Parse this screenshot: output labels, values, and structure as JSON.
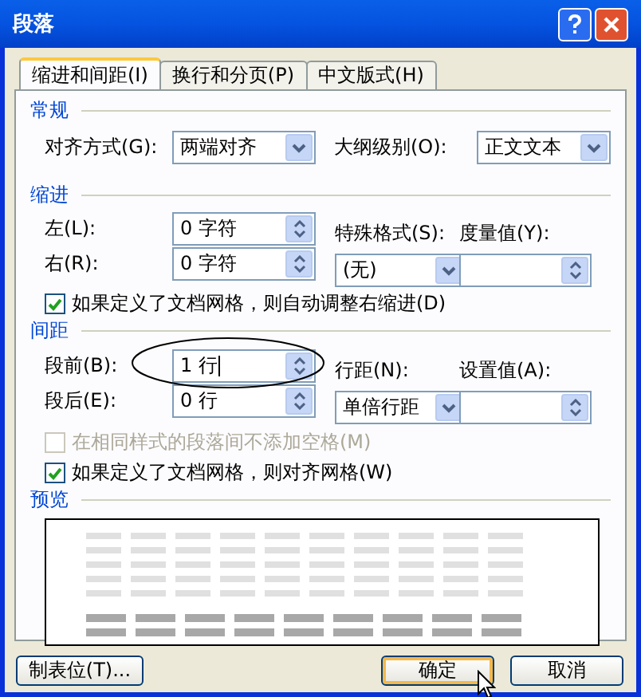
{
  "window": {
    "title": "段落"
  },
  "tabs": [
    {
      "label": "缩进和间距(I)",
      "selected": true
    },
    {
      "label": "换行和分页(P)",
      "selected": false
    },
    {
      "label": "中文版式(H)",
      "selected": false
    }
  ],
  "general": {
    "heading": "常规",
    "alignment": {
      "label": "对齐方式(G):",
      "value": "两端对齐"
    },
    "outline_level": {
      "label": "大纲级别(O):",
      "value": "正文文本"
    }
  },
  "indentation": {
    "heading": "缩进",
    "left": {
      "label": "左(L):",
      "value": "0 字符"
    },
    "right": {
      "label": "右(R):",
      "value": "0 字符"
    },
    "special": {
      "label": "特殊格式(S):",
      "value": "(无)"
    },
    "by": {
      "label": "度量值(Y):"
    },
    "auto_adjust": {
      "label": "如果定义了文档网格，则自动调整右缩进(D)",
      "checked": true,
      "disabled": false
    }
  },
  "spacing": {
    "heading": "间距",
    "before": {
      "label": "段前(B):",
      "value": "1 行",
      "focused": true
    },
    "after": {
      "label": "段后(E):",
      "value": "0 行"
    },
    "line_spacing": {
      "label": "行距(N):",
      "value": "单倍行距"
    },
    "at": {
      "label": "设置值(A):"
    },
    "no_space": {
      "label": "在相同样式的段落间不添加空格(M)",
      "checked": false,
      "disabled": true
    },
    "snap": {
      "label": "如果定义了文档网格，则对齐网格(W)",
      "checked": true,
      "disabled": false
    }
  },
  "preview": {
    "heading": "预览"
  },
  "buttons": [
    {
      "label": "制表位(T)...",
      "default": false
    },
    {
      "label": "确定",
      "default": true
    },
    {
      "label": "取消",
      "default": false
    }
  ]
}
